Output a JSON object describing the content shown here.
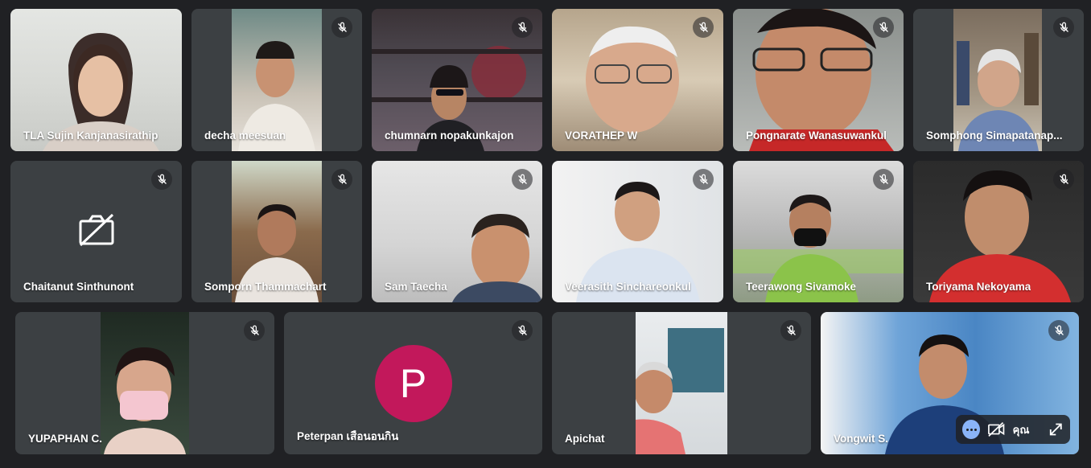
{
  "participants": [
    {
      "name": "TLA Sujin Kanjanasirathip",
      "muted": false
    },
    {
      "name": "decha meesuan",
      "muted": true
    },
    {
      "name": "chumnarn nopakunkajon",
      "muted": true
    },
    {
      "name": "VORATHEP W",
      "muted": true
    },
    {
      "name": "Pongnarate Wanasuwankul",
      "muted": true
    },
    {
      "name": "Somphong Simapatanap...",
      "muted": true
    },
    {
      "name": "Chaitanut Sinthunont",
      "muted": true,
      "camera_off": true
    },
    {
      "name": "Somporn Thammachart",
      "muted": true
    },
    {
      "name": "Sam Taecha",
      "muted": true
    },
    {
      "name": "Veerasith Sinchareonkul",
      "muted": true
    },
    {
      "name": "Teerawong Sivamoke",
      "muted": true
    },
    {
      "name": "Toriyama Nekoyama",
      "muted": true
    },
    {
      "name": "YUPAPHAN C.",
      "muted": true
    },
    {
      "name": "Peterpan เสือนอนกิน",
      "muted": true,
      "avatar_letter": "P"
    },
    {
      "name": "Apichat",
      "muted": true
    },
    {
      "name": "Vongwit S.",
      "muted": true
    }
  ],
  "self_view": {
    "label": "คุณ"
  },
  "colors": {
    "background": "#202124",
    "tile": "#3c4043",
    "avatar": "#c2185b",
    "menu_accent": "#8ab4f8"
  }
}
